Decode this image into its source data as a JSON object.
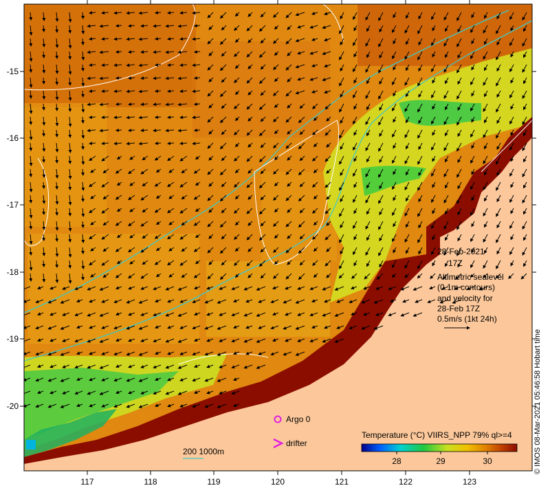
{
  "map": {
    "lon_ticks": [
      "117",
      "118",
      "119",
      "120",
      "121",
      "122",
      "123"
    ],
    "lat_ticks": [
      "-15",
      "-16",
      "-17",
      "-18",
      "-19",
      "-20"
    ],
    "colors": {
      "ocean_warm": "#e08a12",
      "ocean_hot": "#c25a08",
      "ocean_cool": "#e8b010",
      "shelf_yellow": "#d8e020",
      "shelf_green": "#2ec840",
      "coast_dark": "#8b0d00",
      "land": "#fcc89b",
      "contour": "#ffffff",
      "isobath": "#40c8c8",
      "argo": "#e020e0",
      "drifter": "#e020e0"
    }
  },
  "info": {
    "date": "28-Feb-2021",
    "time": "17Z",
    "line1": "Altimetric sealevel",
    "line2": "(0.1m contours)",
    "line3": "and velocity for",
    "line4": "28-Feb 17Z",
    "line5": "0.5m/s (1kt 24h)"
  },
  "legend": {
    "argo": "Argo 0",
    "drifter": "drifter",
    "depth": "200  1000m"
  },
  "colorbar": {
    "title": "Temperature (°C) VIIRS_NPP 79% ql>=4",
    "ticks": [
      "28",
      "29",
      "30"
    ],
    "stops": [
      "#00008b",
      "#0060ff",
      "#00d0d0",
      "#20c840",
      "#c8e020",
      "#f0c000",
      "#e08000",
      "#c04000",
      "#8b0d00"
    ]
  },
  "credit": "© IMOS 08-Mar-2021 05:46:58 Hobart time"
}
